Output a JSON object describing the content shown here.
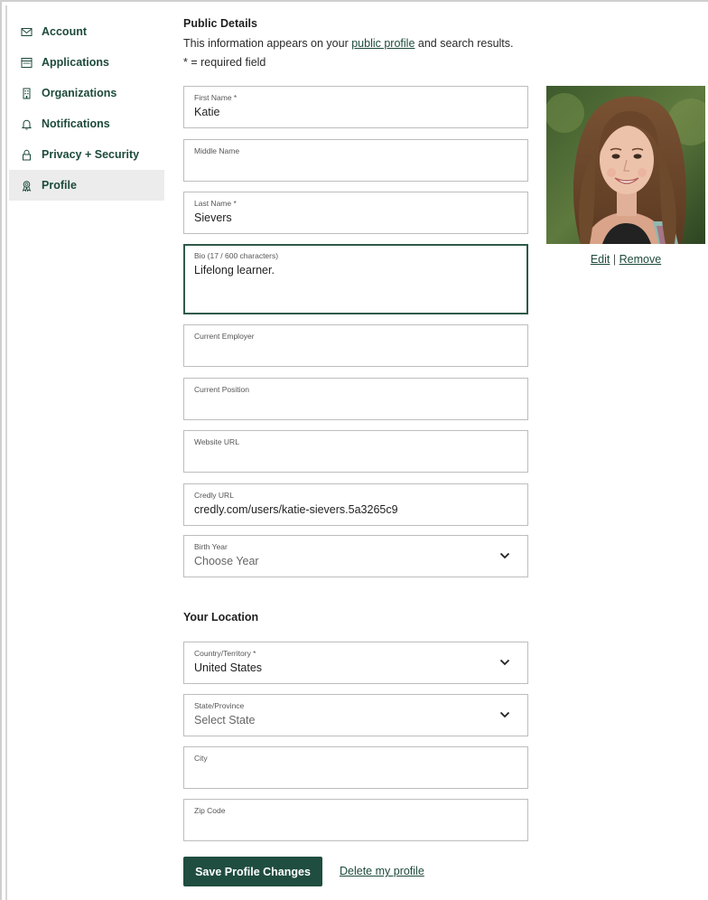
{
  "sidebar": {
    "items": [
      {
        "label": "Account",
        "icon": "envelope-icon"
      },
      {
        "label": "Applications",
        "icon": "browser-window-icon"
      },
      {
        "label": "Organizations",
        "icon": "building-icon"
      },
      {
        "label": "Notifications",
        "icon": "bell-icon"
      },
      {
        "label": "Privacy + Security",
        "icon": "lock-icon"
      },
      {
        "label": "Profile",
        "icon": "badge-icon",
        "active": true
      }
    ]
  },
  "public_details": {
    "heading": "Public Details",
    "intro_before": "This information appears on your ",
    "intro_link": "public profile",
    "intro_after": " and search results.",
    "required_note": "* = required field"
  },
  "fields": {
    "first_name": {
      "label": "First Name *",
      "value": "Katie"
    },
    "middle_name": {
      "label": "Middle Name",
      "value": ""
    },
    "last_name": {
      "label": "Last Name *",
      "value": "Sievers"
    },
    "bio": {
      "label": "Bio (17 / 600 characters)",
      "value": "Lifelong learner."
    },
    "current_employer": {
      "label": "Current Employer",
      "value": ""
    },
    "current_position": {
      "label": "Current Position",
      "value": ""
    },
    "website_url": {
      "label": "Website URL",
      "value": ""
    },
    "credly_url": {
      "label": "Credly URL",
      "value": "credly.com/users/katie-sievers.5a3265c9"
    },
    "birth_year": {
      "label": "Birth Year",
      "placeholder": "Choose Year"
    }
  },
  "location": {
    "heading": "Your Location",
    "country": {
      "label": "Country/Territory *",
      "value": "United States"
    },
    "state": {
      "label": "State/Province",
      "placeholder": "Select State"
    },
    "city": {
      "label": "City",
      "value": ""
    },
    "zip": {
      "label": "Zip Code",
      "value": ""
    }
  },
  "photo": {
    "edit_label": "Edit",
    "separator": "|",
    "remove_label": "Remove"
  },
  "actions": {
    "save_label": "Save Profile Changes",
    "delete_label": "Delete my profile"
  },
  "colors": {
    "brand": "#1f4d3f",
    "nav_text": "#1d4a3a",
    "active_bg": "#ececec",
    "field_border": "#bdbdbd"
  }
}
